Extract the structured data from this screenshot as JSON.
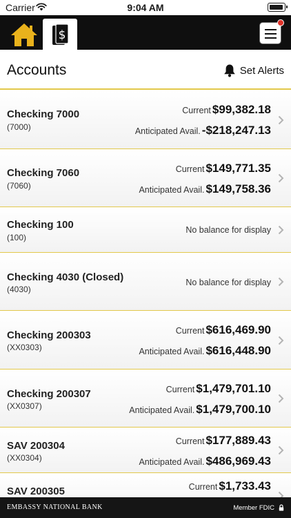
{
  "status_bar": {
    "carrier": "Carrier",
    "time": "9:04 AM"
  },
  "header": {
    "home_icon": "home-icon",
    "accounts_icon": "dollar-card-icon",
    "menu_icon": "hamburger-menu-icon",
    "brand_color": "#e9b21c",
    "badge_color": "#e03228"
  },
  "page": {
    "title": "Accounts",
    "set_alerts_label": "Set Alerts"
  },
  "accounts": [
    {
      "name": "Checking 7000",
      "number": "(7000)",
      "current_label": "Current",
      "current": "$99,382.18",
      "anticipated_label": "Anticipated Avail.",
      "anticipated": "-$218,247.13"
    },
    {
      "name": "Checking 7060",
      "number": "(7060)",
      "current_label": "Current",
      "current": "$149,771.35",
      "anticipated_label": "Anticipated Avail.",
      "anticipated": "$149,758.36"
    },
    {
      "name": "Checking 100",
      "number": "(100)",
      "no_balance": "No balance for display"
    },
    {
      "name": "Checking 4030 (Closed)",
      "number": "(4030)",
      "no_balance": "No balance for display"
    },
    {
      "name": "Checking 200303",
      "number": "(XX0303)",
      "current_label": "Current",
      "current": "$616,469.90",
      "anticipated_label": "Anticipated Avail.",
      "anticipated": "$616,448.90"
    },
    {
      "name": "Checking 200307",
      "number": "(XX0307)",
      "current_label": "Current",
      "current": "$1,479,701.10",
      "anticipated_label": "Anticipated Avail.",
      "anticipated": "$1,479,700.10"
    },
    {
      "name": "SAV 200304",
      "number": "(XX0304)",
      "current_label": "Current",
      "current": "$177,889.43",
      "anticipated_label": "Anticipated Avail.",
      "anticipated": "$486,969.43"
    },
    {
      "name": "SAV 200305",
      "number": "",
      "current_label": "Current",
      "current": "$1,733.43"
    }
  ],
  "footer": {
    "bank_name": "EMBASSY NATIONAL BANK",
    "fdic": "Member FDIC"
  }
}
